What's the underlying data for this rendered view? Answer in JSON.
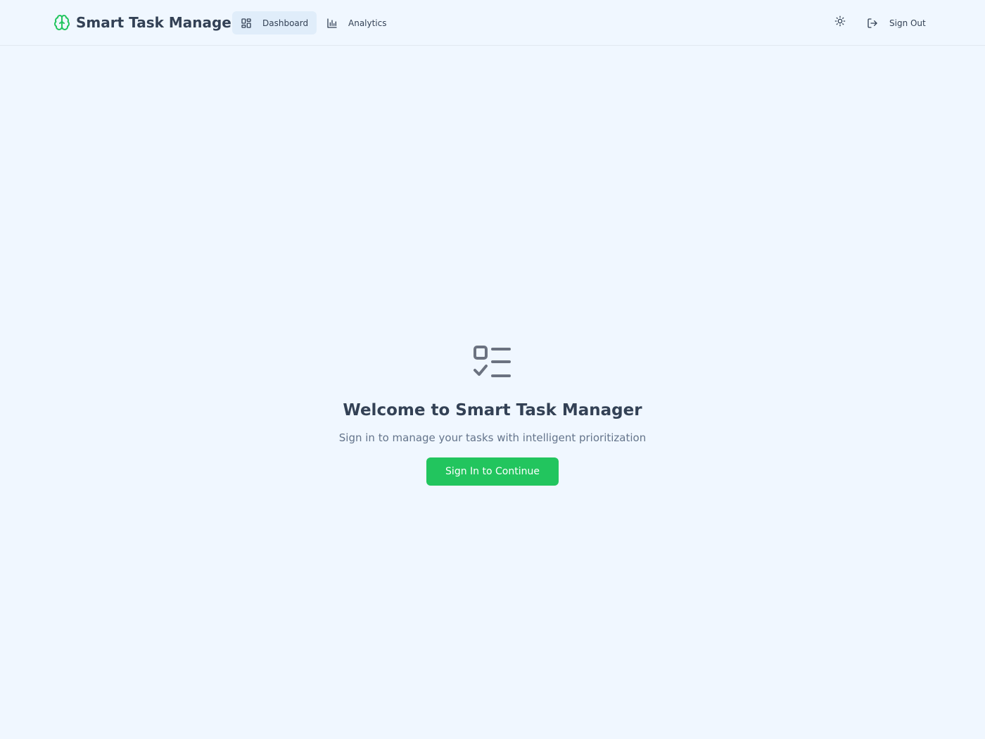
{
  "app": {
    "title": "Smart Task Manager",
    "brand_icon": "brain-icon"
  },
  "nav": {
    "items": [
      {
        "label": "Dashboard",
        "icon": "dashboard-grid-icon",
        "active": true
      },
      {
        "label": "Analytics",
        "icon": "bar-chart-icon",
        "active": false
      }
    ]
  },
  "header_actions": {
    "theme_toggle_icon": "sun-icon",
    "signout_label": "Sign Out",
    "signout_icon": "log-out-icon"
  },
  "welcome": {
    "icon": "checklist-icon",
    "title": "Welcome to Smart Task Manager",
    "subtitle": "Sign in to manage your tasks with intelligent prioritization",
    "button_label": "Sign In to Continue"
  },
  "colors": {
    "accent": "#22c55e",
    "background": "#f0f7ff",
    "active_nav_bg": "#e0edfa",
    "text": "#334155",
    "muted_text": "#64748b"
  }
}
